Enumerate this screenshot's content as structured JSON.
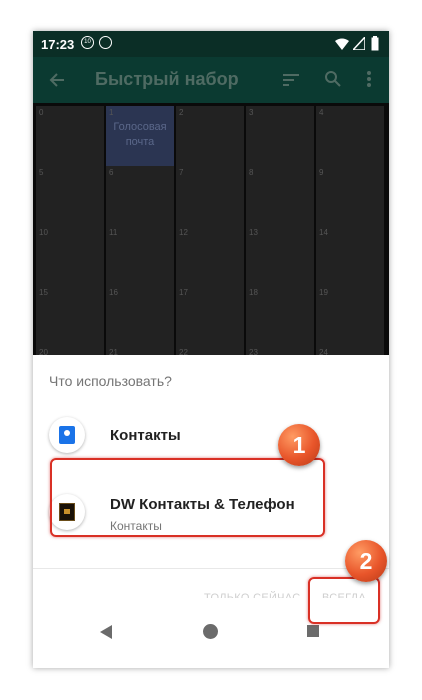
{
  "status_bar": {
    "time": "17:23",
    "icons": [
      "data-saver-icon",
      "sync-icon",
      "wifi-icon",
      "cellular-icon",
      "battery-icon"
    ]
  },
  "app_bar": {
    "title": "Быстрый набор",
    "icons": [
      "back-arrow-icon",
      "sort-icon",
      "search-icon",
      "more-vert-icon"
    ]
  },
  "grid": {
    "rows": [
      [
        "0",
        "1",
        "2",
        "3",
        "4"
      ],
      [
        "5",
        "6",
        "7",
        "8",
        "9"
      ],
      [
        "10",
        "11",
        "12",
        "13",
        "14"
      ],
      [
        "15",
        "16",
        "17",
        "18",
        "19"
      ],
      [
        "20",
        "21",
        "22",
        "23",
        "24"
      ]
    ],
    "voicemail_label": "Голосовая почта"
  },
  "dialog": {
    "title": "Что использовать?",
    "apps": [
      {
        "name": "Контакты",
        "subtitle": "",
        "icon": "contacts-app-icon"
      },
      {
        "name": "DW Контакты & Телефон",
        "subtitle": "Контакты",
        "icon": "dw-contacts-app-icon"
      }
    ],
    "just_once": "ТОЛЬКО СЕЙЧАС",
    "always": "ВСЕГДА"
  },
  "annotations": {
    "badge1": "1",
    "badge2": "2",
    "highlight_color": "#d93025",
    "badge_color": "#e8552a"
  },
  "nav": {
    "icons": [
      "nav-back-icon",
      "nav-home-icon",
      "nav-recents-icon"
    ]
  }
}
